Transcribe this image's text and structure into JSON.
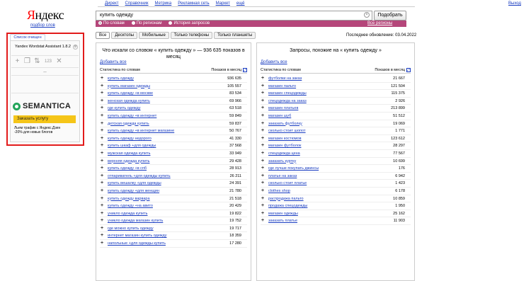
{
  "nav": {
    "items": [
      "Директ",
      "Справочник",
      "Метрика",
      "Рекламная сеть",
      "Маркет",
      "ещё"
    ],
    "exit": "Выход"
  },
  "logo": {
    "first_letter": "Я",
    "rest": "ндекс",
    "subtitle": "подбор слов"
  },
  "search": {
    "query": "купить одежду",
    "button": "Подобрать"
  },
  "search_mode": {
    "options": [
      "По словам",
      "По регионам",
      "История запросов"
    ],
    "selected": "По словам",
    "regions_link": "Все регионы"
  },
  "device_tabs": {
    "items": [
      "Все",
      "Десктопы",
      "Мобильные",
      "Только телефоны",
      "Только планшеты"
    ],
    "active": "Все"
  },
  "last_update": "Последнее обновление: 03.04.2022",
  "plugin": {
    "tab_label": "Список очищен",
    "name": "Yandex Wordstat Assistant 1.8.2",
    "counter": "123",
    "brand": "SEMANTICA",
    "order_button": "Заказать услугу",
    "promo_line1": "Льем трафик с Яндекс.Дзен",
    "promo_line2": "-20% для новых блогов"
  },
  "left_panel": {
    "title": "Что искали со словом « купить одежду » — 936 635 показов в месяц",
    "add_all": "Добавить все",
    "col_query": "Статистика по словам",
    "col_count": "Показов в месяц",
    "rows": [
      [
        "купить одежду",
        "936 635"
      ],
      [
        "купить магазин одежды",
        "105 557"
      ],
      [
        "купить одежду +в москве",
        "83 534"
      ],
      [
        "женская одежда купить",
        "69 966"
      ],
      [
        "где купить одежду",
        "63 518"
      ],
      [
        "купить одежду +в интернет",
        "59 849"
      ],
      [
        "детская одежда купить",
        "59 837"
      ],
      [
        "купить одежду +в интернет магазине",
        "50 767"
      ],
      [
        "купить одежду недорого",
        "41 330"
      ],
      [
        "купить шкаф +для одежды",
        "37 568"
      ],
      [
        "мужская одежда купить",
        "33 949"
      ],
      [
        "верхняя одежда купить",
        "29 428"
      ],
      [
        "купить одежду +в спб",
        "28 913"
      ],
      [
        "отпариватель +для одежды купить",
        "26 211"
      ],
      [
        "купить вешалку +для одежды",
        "24 391"
      ],
      [
        "купить одежду +для женщин",
        "21 780"
      ],
      [
        "купить одежду варвара",
        "21 518"
      ],
      [
        "купить одежду +на авито",
        "20 429"
      ],
      [
        "уникло одежда купить",
        "19 822"
      ],
      [
        "уникло одежда магазин купить",
        "19 752"
      ],
      [
        "где можно купить одежду",
        "19 717"
      ],
      [
        "интернет магазин купить одежду",
        "18 359"
      ],
      [
        "напольные +для одежды купить",
        "17 280"
      ]
    ]
  },
  "right_panel": {
    "title": "Запросы, похожие на « купить одежду »",
    "add_all": "Добавить все",
    "col_query": "Статистика по словам",
    "col_count": "Показов в месяц",
    "rows": [
      [
        "футболки на заказ",
        "21 667"
      ],
      [
        "магазин пальто",
        "121 504"
      ],
      [
        "магазин спецодежды",
        "115 375"
      ],
      [
        "спецодежда на заказ",
        "2 926"
      ],
      [
        "магазин платьев",
        "213 899"
      ],
      [
        "магазин шуб",
        "51 512"
      ],
      [
        "заказать футболку",
        "19 069"
      ],
      [
        "сколько стоит шопот",
        "1 771"
      ],
      [
        "магазин костюмов",
        "123 612"
      ],
      [
        "магазин футболок",
        "28 297"
      ],
      [
        "спецодежда цена",
        "77 567"
      ],
      [
        "заказать куртку",
        "10 699"
      ],
      [
        "где лучше покупать джинсы",
        "176"
      ],
      [
        "платье на заказ",
        "6 942"
      ],
      [
        "сколько стоит платье",
        "1 423"
      ],
      [
        "clothes shop",
        "6 178"
      ],
      [
        "распродажа пальто",
        "10 859"
      ],
      [
        "продажа спецодежды",
        "1 950"
      ],
      [
        "магазин одежды",
        "25 162"
      ],
      [
        "заказать платье",
        "11 903"
      ]
    ]
  },
  "colors": {
    "accent": "#b5467a",
    "link": "#1a3dc1",
    "highlight_frame": "#e21b1b",
    "brand_green": "#23a55a",
    "cta_yellow": "#f5c518"
  }
}
